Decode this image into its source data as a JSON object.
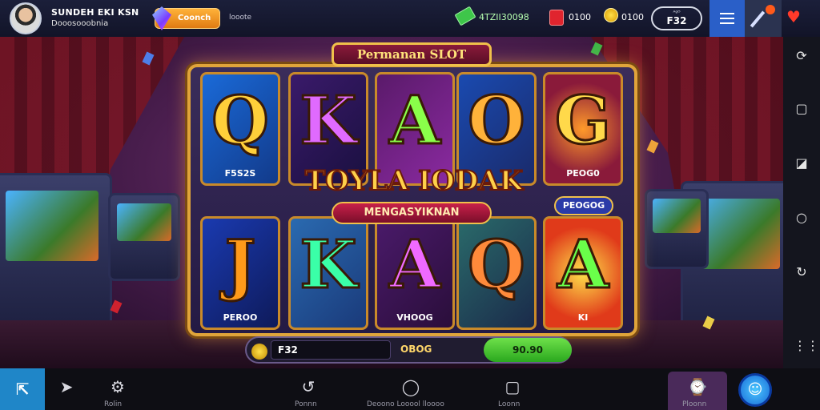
{
  "topbar": {
    "player_name": "SUNDEH EKI KSN",
    "player_sub": "Dooosooobnia",
    "gem_label": "Coonch",
    "misc_label": "looote",
    "cash_value": "4TZII30098",
    "ruby_value": "0100",
    "coin_value": "0100",
    "level_label": "ᴬᵍᴼ",
    "level_value": "F32"
  },
  "slot": {
    "title": "Permanan SLOT",
    "headline": "TOYLA IODAK",
    "subheadline": "MENGASYIKNAN",
    "badge": "PEOGOG",
    "tiles": [
      {
        "letter": "Q",
        "caption": "F5S2S"
      },
      {
        "letter": "K",
        "caption": ""
      },
      {
        "letter": "A",
        "caption": ""
      },
      {
        "letter": "O",
        "caption": ""
      },
      {
        "letter": "G",
        "caption": "PEOG0"
      },
      {
        "letter": "J",
        "caption": "PEROO"
      },
      {
        "letter": "K",
        "caption": ""
      },
      {
        "letter": "A",
        "caption": "VHOOG"
      },
      {
        "letter": "Q",
        "caption": ""
      },
      {
        "letter": "A",
        "caption": "KI"
      }
    ]
  },
  "betbar": {
    "bet_value": "F32",
    "mid_value": "OBOG",
    "win_value": "90.90"
  },
  "bottombar": {
    "item1_label": "Rolin",
    "item2_label": "Ponnn",
    "item3_label": "Deoono Looool lloooo",
    "item4_label": "Loonn",
    "item5_label": "Ploonn"
  }
}
